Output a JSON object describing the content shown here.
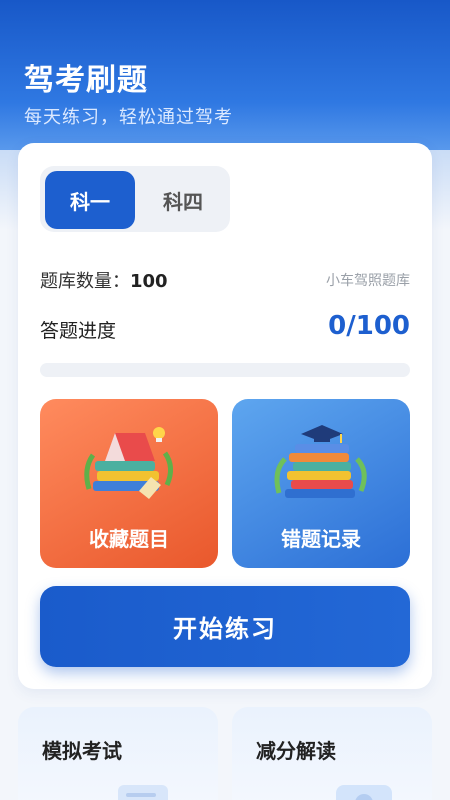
{
  "header": {
    "title": "驾考刷题",
    "subtitle": "每天练习，轻松通过驾考"
  },
  "subjects": {
    "tabs": [
      {
        "label": "科一",
        "active": true
      },
      {
        "label": "科四",
        "active": false
      }
    ]
  },
  "stats": {
    "bank_count_label": "题库数量：",
    "bank_count_value": "100",
    "bank_name": "小车驾照题库",
    "progress_label": "答题进度",
    "progress_value": "0/100",
    "progress_fraction": 0
  },
  "tiles": {
    "favorites_label": "收藏题目",
    "wrong_label": "错题记录"
  },
  "start_button_label": "开始练习",
  "bottom": {
    "exam_title": "模拟考试",
    "reduce_title": "减分解读"
  },
  "colors": {
    "primary": "#1d5fcf",
    "orange_tile": "#ee6a3c",
    "blue_tile": "#3f86e0"
  },
  "icons": {
    "favorites": "books-lightbulb-icon",
    "wrong": "books-graduation-cap-icon"
  }
}
